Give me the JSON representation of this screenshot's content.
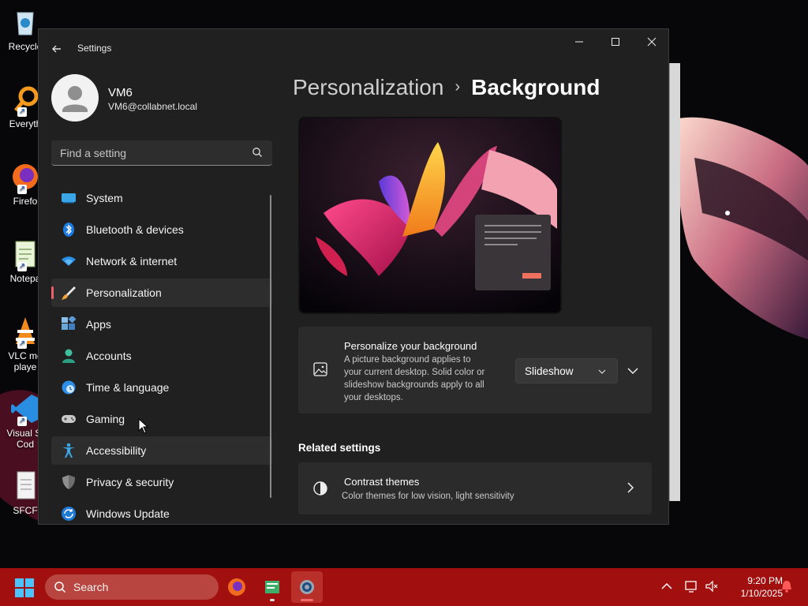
{
  "desktop": {
    "icons": [
      {
        "label": "Recycle",
        "icon": "recycle-bin-icon"
      },
      {
        "label": "Everyth",
        "icon": "everything-search-icon"
      },
      {
        "label": "Firefo",
        "icon": "firefox-icon"
      },
      {
        "label": "Notepa",
        "icon": "notepad-icon"
      },
      {
        "label": "VLC me\nplaye",
        "icon": "vlc-icon"
      },
      {
        "label": "Visual St\nCod",
        "icon": "vscode-icon"
      },
      {
        "label": "SFCF",
        "icon": "file-icon"
      }
    ]
  },
  "window": {
    "title": "Settings",
    "user": {
      "name": "VM6",
      "email": "VM6@collabnet.local"
    },
    "search": {
      "placeholder": "Find a setting"
    },
    "nav": [
      {
        "label": "System",
        "icon": "system-icon"
      },
      {
        "label": "Bluetooth & devices",
        "icon": "bluetooth-icon"
      },
      {
        "label": "Network & internet",
        "icon": "wifi-icon"
      },
      {
        "label": "Personalization",
        "icon": "brush-icon",
        "active": true
      },
      {
        "label": "Apps",
        "icon": "apps-icon"
      },
      {
        "label": "Accounts",
        "icon": "accounts-icon"
      },
      {
        "label": "Time & language",
        "icon": "time-language-icon"
      },
      {
        "label": "Gaming",
        "icon": "gaming-icon"
      },
      {
        "label": "Accessibility",
        "icon": "accessibility-icon",
        "hover": true
      },
      {
        "label": "Privacy & security",
        "icon": "shield-icon"
      },
      {
        "label": "Windows Update",
        "icon": "update-icon"
      }
    ],
    "breadcrumb": {
      "parent": "Personalization",
      "separator": "›",
      "current": "Background"
    },
    "background_card": {
      "title": "Personalize your background",
      "description": "A picture background applies to your current desktop. Solid color or slideshow backgrounds apply to all your desktops.",
      "description_lines": [
        "A picture background applies to",
        "your current desktop. Solid color or",
        "slideshow backgrounds apply to all",
        "your desktops."
      ],
      "dropdown_value": "Slideshow"
    },
    "related_settings": {
      "heading": "Related settings",
      "items": [
        {
          "title": "Contrast themes",
          "description": "Color themes for low vision, light sensitivity"
        }
      ]
    }
  },
  "taskbar": {
    "search_label": "Search",
    "apps": [
      "firefox-icon",
      "notepad-icon",
      "settings-icon"
    ],
    "clock": {
      "time": "9:20 PM",
      "date": "1/10/2025"
    }
  },
  "colors": {
    "accent": "#f0606a",
    "taskbar": "#a20f0f",
    "window_bg": "#202020",
    "card_bg": "#2b2b2b"
  }
}
